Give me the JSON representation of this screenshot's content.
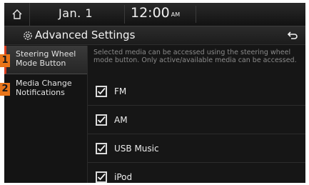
{
  "status": {
    "date": "Jan.  1",
    "time": "12:00",
    "ampm": "AM"
  },
  "title": "Advanced Settings",
  "sidebar": {
    "items": [
      {
        "badge": "1",
        "label_line1": "Steering Wheel",
        "label_line2": "Mode Button",
        "active": true
      },
      {
        "badge": "2",
        "label_line1": "Media Change",
        "label_line2": "Notifications",
        "active": false
      }
    ]
  },
  "main": {
    "description": "Selected media can be accessed using the steering wheel mode button. Only active/available media can be accessed.",
    "options": [
      {
        "label": "FM",
        "checked": true
      },
      {
        "label": "AM",
        "checked": true
      },
      {
        "label": "USB Music",
        "checked": true
      },
      {
        "label": "iPod",
        "checked": true
      }
    ]
  },
  "colors": {
    "accent": "#d73a1c",
    "badge": "#e8751a",
    "background": "#161616"
  },
  "icons": {
    "home": "home-icon",
    "settings": "gear-icon",
    "back": "back-arrow-icon",
    "check": "checkmark-icon"
  }
}
